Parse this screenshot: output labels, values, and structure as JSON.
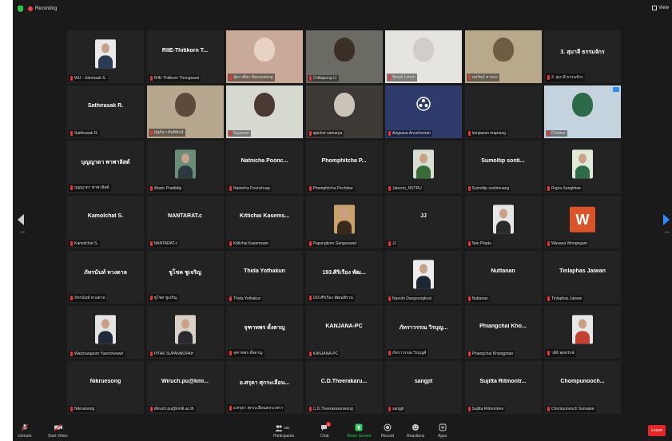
{
  "app": {
    "recording_label": "Recording",
    "view_label": "View",
    "page_left": "1/3",
    "page_right": "1/3"
  },
  "participants": [
    {
      "big": "",
      "name": "WU - Udomsak S.",
      "video": "avatar",
      "bg": "#e9e9e9",
      "fg": "#2b3a55"
    },
    {
      "big": "RIIE-Thitikorn T...",
      "name": "RIIE-Thitikorn Thongsaed",
      "video": ""
    },
    {
      "big": "",
      "name": "นุ้ยรวดีพร Maneewong",
      "video": "cam",
      "bg": "#c9a997",
      "fg": "#e8d2c4"
    },
    {
      "big": "",
      "name": "Chittapong U.",
      "video": "cam",
      "bg": "#6b6a63",
      "fg": "#3b3025",
      "active": true
    },
    {
      "big": "",
      "name": "นิพนธ์ Lorem",
      "video": "cam",
      "bg": "#e6e4df",
      "fg": "#d1cec7"
    },
    {
      "big": "",
      "name": "นพรัตน์ หาทอง",
      "video": "cam",
      "bg": "#b9a98c",
      "fg": "#6f5c43"
    },
    {
      "big": "3. สุมาลี ธรรมจักร",
      "name": "3. สุมาลี ธรรมจักร",
      "video": ""
    },
    {
      "big": "Sathirasak R.",
      "name": "Sathirasak R.",
      "video": ""
    },
    {
      "big": "",
      "name": "ณัฐธิดา ศิลพิทักษ์",
      "video": "cam",
      "bg": "#b8a78f",
      "fg": "#5d4a3a"
    },
    {
      "big": "",
      "name": "Supanan",
      "video": "cam",
      "bg": "#d5d9d0",
      "fg": "#4a3a33"
    },
    {
      "big": "",
      "name": "apichet samarya",
      "video": "cam",
      "bg": "#3d3a35",
      "fg": "#c9c3b8"
    },
    {
      "big": "",
      "name": "Angsana Anucharnan",
      "video": "obs",
      "bg": "#2f3b6b",
      "fg": "#ffffff"
    },
    {
      "big": "",
      "name": "benjawan maprang",
      "video": ""
    },
    {
      "big": "",
      "name": "Chattee",
      "video": "cam",
      "bg": "#c4d3dd",
      "fg": "#2d6a4a"
    },
    {
      "big": "บุญญาดา พาพาลิสต์",
      "name": "บุญญาดา พาพาลิสต์",
      "video": ""
    },
    {
      "big": "",
      "name": "Wasin Praditdip",
      "video": "avatar",
      "bg": "#6b8d7a",
      "fg": "#2c3a3f"
    },
    {
      "big": "Natnicha Poonc...",
      "name": "Natnicha Poonchuay",
      "video": ""
    },
    {
      "big": "Phomphitcha P...",
      "name": "Phomphitcha Pechdee",
      "video": ""
    },
    {
      "big": "",
      "name": "Jaturon_NSTRU",
      "video": "avatar",
      "bg": "#d7dfd2",
      "fg": "#3a6b3b"
    },
    {
      "big": "Sumoltip sonti...",
      "name": "Sumoltip sontimuang",
      "video": ""
    },
    {
      "big": "",
      "name": "Rujira Sangkhae",
      "video": "avatar",
      "bg": "#e2e9d9",
      "fg": "#2f6b4a"
    },
    {
      "big": "Kamolchat S.",
      "name": "Kamolchat S.",
      "video": ""
    },
    {
      "big": "NANTARAT.c",
      "name": "NANTARAT.c",
      "video": ""
    },
    {
      "big": "Kittichai Kasems...",
      "name": "Kittichai Kasemsam",
      "video": ""
    },
    {
      "big": "",
      "name": "Papungkorn Sangsawad",
      "video": "avatar",
      "bg": "#c9a16b",
      "fg": "#3a2a1c"
    },
    {
      "big": "JJ",
      "name": "JJ",
      "video": ""
    },
    {
      "big": "",
      "name": "Nan Pilada",
      "video": "avatar",
      "bg": "#e6e6e6",
      "fg": "#2a2a2a"
    },
    {
      "big": "",
      "name": "Wasana Wongngam",
      "video": "wlogo",
      "bg": "#d9532b",
      "fg": "#ffffff"
    },
    {
      "big": "ภัทรนันท์ ทวงตาล",
      "name": "ภัทรนันท์ ทวงตาล",
      "video": ""
    },
    {
      "big": "ชูโชค ชูเจริญ",
      "name": "ชูโชค ชูเจริญ",
      "video": ""
    },
    {
      "big": "Thida Yothakun",
      "name": "Thida Yothakun",
      "video": ""
    },
    {
      "big": "193.ศิริเรือง พัฒ...",
      "name": "193.ศิริเรือง พัฒนพิรวน",
      "video": ""
    },
    {
      "big": "",
      "name": "Nanoln Dangsungkval",
      "video": "avatar",
      "bg": "#ececec",
      "fg": "#1e2633"
    },
    {
      "big": "Nuttanan",
      "name": "Nuttanan",
      "video": ""
    },
    {
      "big": "Tinlaphas Jaiwan",
      "name": "Tinlaphas Jaiwan",
      "video": ""
    },
    {
      "big": "",
      "name": "Watcharaporn Yuencheewit",
      "video": "avatar",
      "bg": "#e4e4e4",
      "fg": "#1f2a3a"
    },
    {
      "big": "",
      "name": "PITAK SUPANNOPAH",
      "video": "avatar",
      "bg": "#d8d2c6",
      "fg": "#2c2a30"
    },
    {
      "big": "จุฑาทพร ตั้งตาญ",
      "name": "จุฑาทพร ตั้งตาญ",
      "video": ""
    },
    {
      "big": "KANJANA-PC",
      "name": "KANJANA-PC",
      "video": ""
    },
    {
      "big": "ภัทราวรรณ วิรบุญ...",
      "name": "ภัทราวรรณ วิรบุญศ์",
      "video": ""
    },
    {
      "big": "Phiangchai Kho...",
      "name": "Phiangchai Khongphan",
      "video": ""
    },
    {
      "big": "",
      "name": "วลีย์ พุทธรักษ์",
      "video": "avatar",
      "bg": "#e7e7e7",
      "fg": "#c2422f"
    },
    {
      "big": "Nikruesong",
      "name": "Nikruesong",
      "video": ""
    },
    {
      "big": "Wiruch.pu@kmi...",
      "name": "Wiruch.pu@kmitl.ac.th",
      "video": ""
    },
    {
      "big": "อ.ศรุดา ศุกระเลื่อน...",
      "name": "อ.ศรุดา ศุกระเลื่อนสงกะเพรา",
      "video": ""
    },
    {
      "big": "C.D.Theerakaru...",
      "name": "C.D.Theerakarunwong",
      "video": ""
    },
    {
      "big": "sangjit",
      "name": "sangjit",
      "video": ""
    },
    {
      "big": "Sujitta Ritmontr...",
      "name": "Sujitta Ritmontree",
      "video": ""
    },
    {
      "big": "Chompunooch...",
      "name": "Chompunooch Somalee",
      "video": ""
    }
  ],
  "toolbar": {
    "unmute": "Unmute",
    "start_video": "Start Video",
    "participants": "Participants",
    "participants_count": "382",
    "chat": "Chat",
    "chat_badge": "1",
    "share_screen": "Share Screen",
    "record": "Record",
    "reactions": "Reactions",
    "apps": "Apps",
    "leave": "Leave"
  },
  "colors": {
    "frame": "#1a1a1a",
    "tile": "#232323",
    "active_speaker": "#c6e63c",
    "mic_muted": "#e33333",
    "share_screen": "#2ecc57",
    "leave": "#e02828",
    "next_arrow": "#2d8cff"
  }
}
